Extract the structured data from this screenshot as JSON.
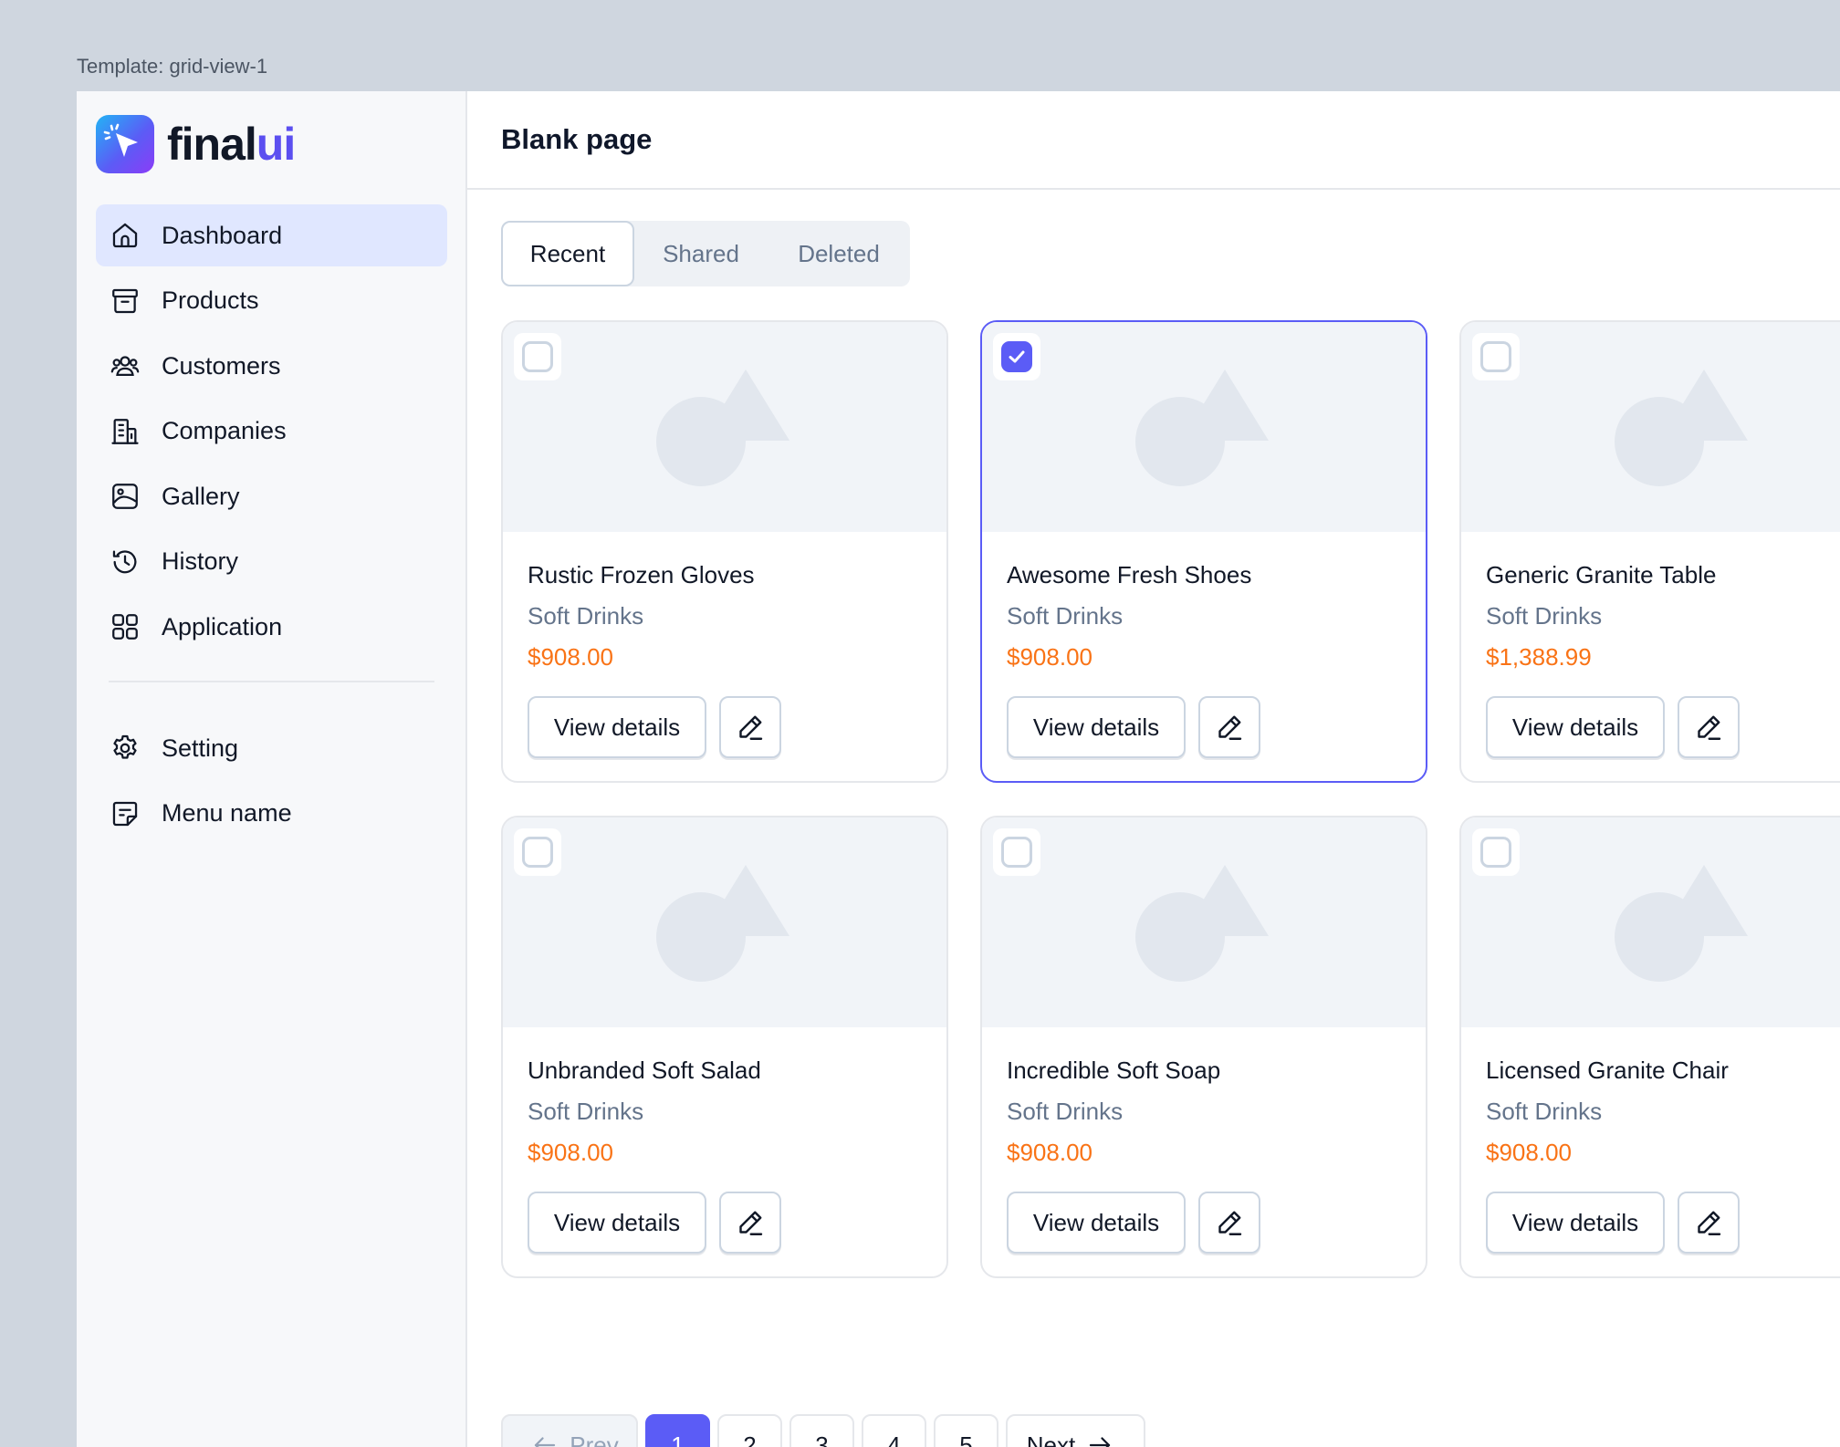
{
  "template_label": "Template: grid-view-1",
  "brand": {
    "name_main": "final",
    "name_accent": "ui",
    "accent_color": "#5b4ff0"
  },
  "sidebar": {
    "items": [
      {
        "label": "Dashboard",
        "icon": "home-icon",
        "active": true
      },
      {
        "label": "Products",
        "icon": "archive-box-icon"
      },
      {
        "label": "Customers",
        "icon": "users-icon"
      },
      {
        "label": "Companies",
        "icon": "building-icon"
      },
      {
        "label": "Gallery",
        "icon": "image-icon"
      },
      {
        "label": "History",
        "icon": "clock-history-icon"
      },
      {
        "label": "Application",
        "icon": "grid-apps-icon"
      }
    ],
    "bottom_items": [
      {
        "label": "Setting",
        "icon": "gear-icon"
      },
      {
        "label": "Menu name",
        "icon": "sticky-note-icon"
      }
    ]
  },
  "header": {
    "title": "Blank page"
  },
  "tabs": [
    {
      "label": "Recent",
      "active": true
    },
    {
      "label": "Shared"
    },
    {
      "label": "Deleted"
    }
  ],
  "products": [
    {
      "title": "Rustic Frozen Gloves",
      "category": "Soft Drinks",
      "price": "$908.00",
      "selected": false
    },
    {
      "title": "Awesome Fresh Shoes",
      "category": "Soft Drinks",
      "price": "$908.00",
      "selected": true
    },
    {
      "title": "Generic Granite Table",
      "category": "Soft Drinks",
      "price": "$1,388.99",
      "selected": false
    },
    {
      "title": "Unbranded Soft Salad",
      "category": "Soft Drinks",
      "price": "$908.00",
      "selected": false
    },
    {
      "title": "Incredible Soft Soap",
      "category": "Soft Drinks",
      "price": "$908.00",
      "selected": false
    },
    {
      "title": "Licensed Granite Chair",
      "category": "Soft Drinks",
      "price": "$908.00",
      "selected": false
    }
  ],
  "card_actions": {
    "view_label": "View details"
  },
  "pagination": {
    "prev_label": "Prev",
    "next_label": "Next",
    "pages": [
      "1",
      "2",
      "3",
      "4",
      "5"
    ],
    "current": "1"
  },
  "colors": {
    "primary": "#5b5cf6",
    "price": "#f97316",
    "muted": "#64748b",
    "active_nav_bg": "#e0e7ff"
  }
}
